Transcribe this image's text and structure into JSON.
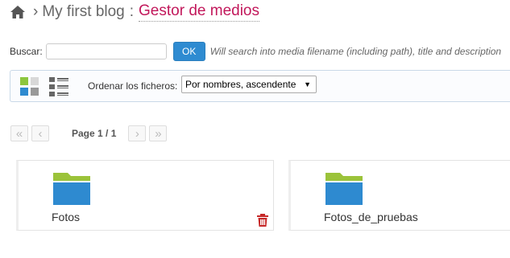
{
  "breadcrumb": {
    "home_icon": "home-icon",
    "separator": "›",
    "blog_name": "My first blog",
    "colon": ":",
    "current_page": "Gestor de medios"
  },
  "search": {
    "label": "Buscar:",
    "value": "",
    "placeholder": "",
    "button_label": "OK",
    "hint": "Will search into media filename (including path), title and description"
  },
  "view_bar": {
    "grid_view_icon": "grid-view-icon",
    "list_view_icon": "list-view-icon",
    "sort_label": "Ordenar los ficheros:",
    "sort_value": "Por nombres, ascendente"
  },
  "pager": {
    "first_label": "«",
    "prev_label": "‹",
    "page_info": "Page 1 / 1",
    "next_label": "›",
    "last_label": "»"
  },
  "folders": [
    {
      "name": "Fotos",
      "icon": "folder-icon",
      "has_delete": true
    },
    {
      "name": "Fotos_de_pruebas",
      "icon": "folder-icon",
      "has_delete": false
    }
  ],
  "colors": {
    "accent": "#c2185b",
    "button_blue": "#2e8bd1",
    "folder_top": "#9bc33a",
    "folder_body": "#2e8ad0",
    "delete_red": "#c62828"
  }
}
